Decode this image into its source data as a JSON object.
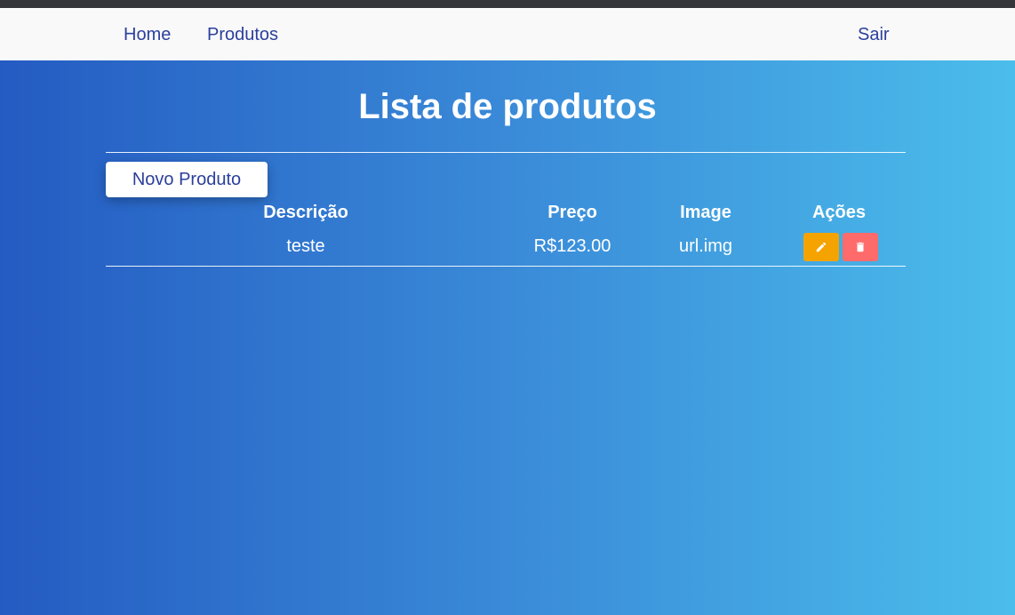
{
  "nav": {
    "home": "Home",
    "produtos": "Produtos",
    "sair": "Sair"
  },
  "page": {
    "title": "Lista de produtos",
    "new_button": "Novo Produto"
  },
  "table": {
    "headers": [
      "Descrição",
      "Preço",
      "Image",
      "Ações"
    ],
    "rows": [
      {
        "descricao": "teste",
        "preco": "R$123.00",
        "image": "url.img",
        "actions": [
          "pencil-icon",
          "trash-icon"
        ]
      }
    ]
  },
  "colors": {
    "edit_button": "#f4a300",
    "delete_button": "#ff6b6b",
    "nav_text": "#2b3f9c"
  }
}
